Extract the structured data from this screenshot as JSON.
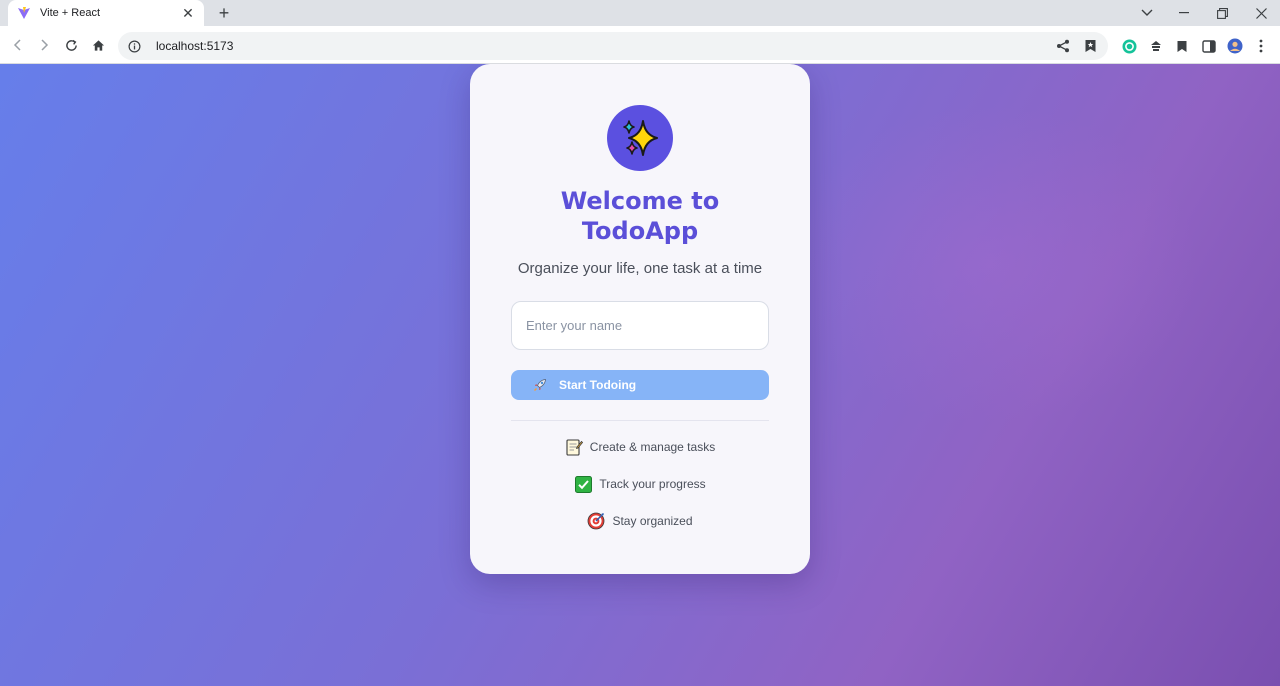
{
  "browser": {
    "tab_title": "Vite + React",
    "url": "localhost:5173"
  },
  "page": {
    "title_line1": "Welcome to",
    "title_line2": "TodoApp",
    "subtitle": "Organize your life, one task at a time",
    "name_input": {
      "placeholder": "Enter your name",
      "value": ""
    },
    "start_button_label": "Start Todoing",
    "features": [
      {
        "icon": "memo-icon",
        "label": "Create & manage tasks"
      },
      {
        "icon": "check-box-icon",
        "label": "Track your progress"
      },
      {
        "icon": "target-icon",
        "label": "Stay organized"
      }
    ]
  },
  "colors": {
    "accent": "#5b4fd8",
    "button": "#86b4f7",
    "gradient_start": "#667eea",
    "gradient_end": "#7a4fb0"
  }
}
